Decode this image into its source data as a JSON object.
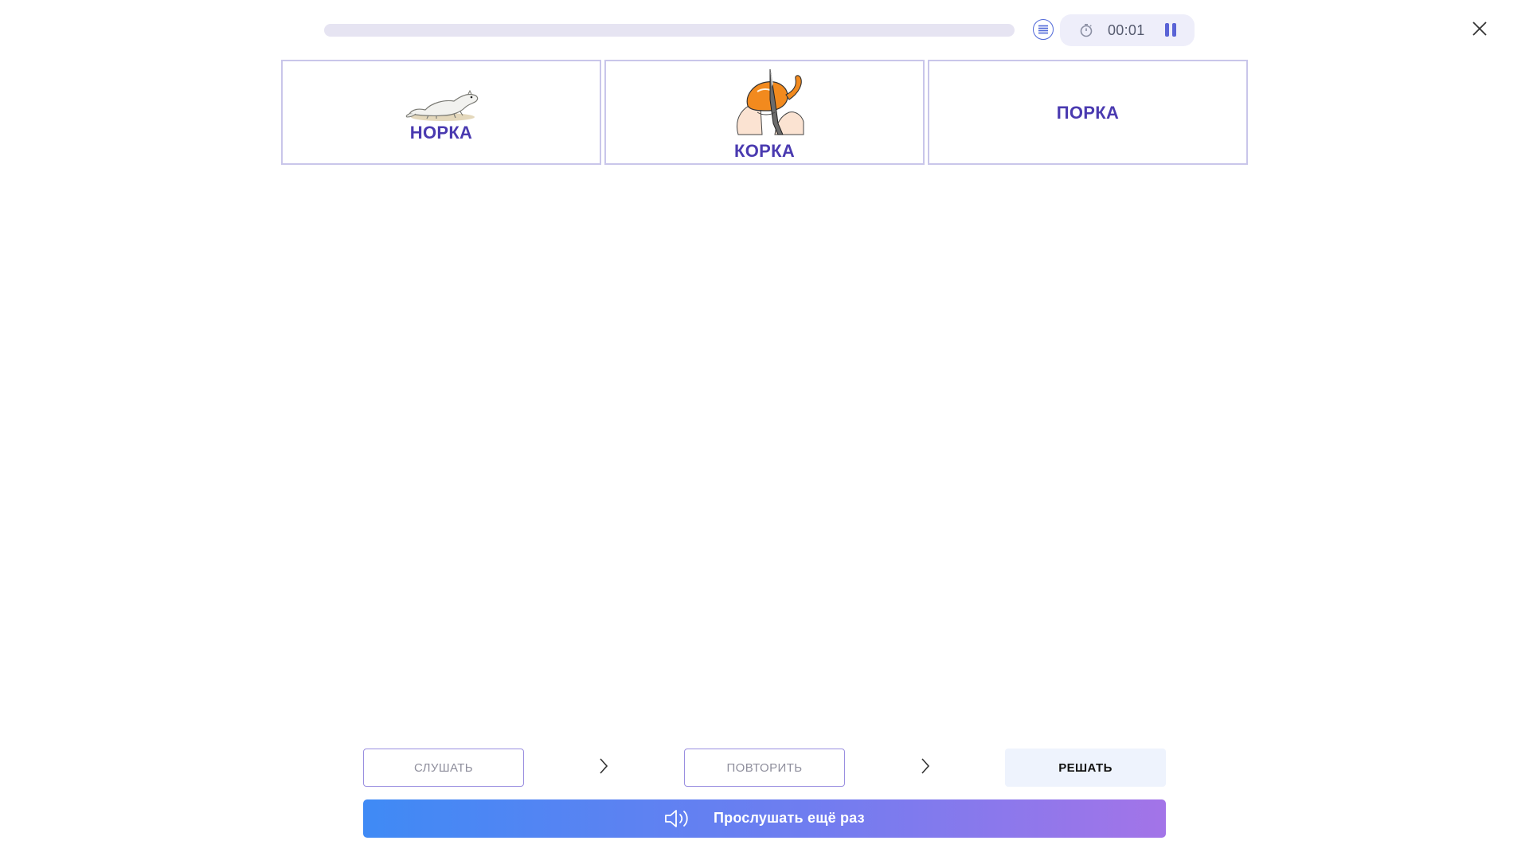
{
  "header": {
    "progress": 0,
    "timer": "00:01",
    "icons": {
      "list": "list-icon",
      "timer": "stopwatch-icon",
      "pause": "pause-icon",
      "close": "close-icon"
    }
  },
  "cards": [
    {
      "label": "НОРКА",
      "image": "ferret-image"
    },
    {
      "label": "КОРКА",
      "image": "peeling-orange-image"
    },
    {
      "label": "ПОРКА",
      "image": ""
    }
  ],
  "steps": {
    "listen": "СЛУШАТЬ",
    "repeat": "ПОВТОРИТЬ",
    "solve": "РЕШАТЬ"
  },
  "listen_again": {
    "label": "Прослушать ещё раз",
    "icon": "speaker-icon"
  },
  "colors": {
    "accent": "#4a3ab0",
    "card_border": "#c9c6ea",
    "button_gradient_start": "#3f8af5",
    "button_gradient_end": "#a374e8"
  }
}
